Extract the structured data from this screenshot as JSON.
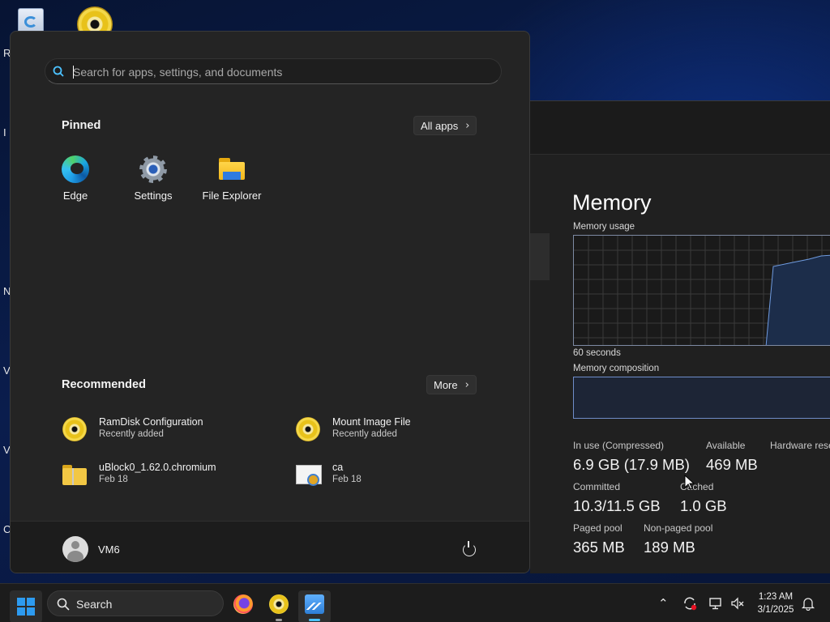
{
  "desktop": {
    "edge_letters": [
      "R",
      "I",
      "N",
      "V",
      "V",
      "C"
    ]
  },
  "start_menu": {
    "search": {
      "placeholder": "Search for apps, settings, and documents",
      "value": ""
    },
    "pinned": {
      "title": "Pinned",
      "all_apps_label": "All apps",
      "items": [
        {
          "label": "Edge",
          "icon": "edge-icon"
        },
        {
          "label": "Settings",
          "icon": "gear-icon"
        },
        {
          "label": "File Explorer",
          "icon": "folder-icon"
        }
      ]
    },
    "recommended": {
      "title": "Recommended",
      "more_label": "More",
      "items": [
        {
          "name": "RamDisk Configuration",
          "sub": "Recently added",
          "icon": "disc-icon"
        },
        {
          "name": "Mount Image File",
          "sub": "Recently added",
          "icon": "disc-icon"
        },
        {
          "name": "uBlock0_1.62.0.chromium",
          "sub": "Feb 18",
          "icon": "zip-folder-icon"
        },
        {
          "name": "ca",
          "sub": "Feb 18",
          "icon": "certificate-icon"
        }
      ]
    },
    "footer": {
      "user_name": "VM6",
      "power_icon": "power-icon"
    }
  },
  "task_manager": {
    "heading": "Memory",
    "memory_usage_label": "Memory usage",
    "graph_time_label": "60 seconds",
    "composition_label": "Memory composition",
    "stats": {
      "in_use_label": "In use (Compressed)",
      "in_use_value": "6.9 GB (17.9 MB)",
      "available_label": "Available",
      "available_value": "469 MB",
      "hardware_reserved_label": "Hardware rese",
      "committed_label": "Committed",
      "committed_value": "10.3/11.5 GB",
      "cached_label": "Cached",
      "cached_value": "1.0 GB",
      "paged_pool_label": "Paged pool",
      "paged_pool_value": "365 MB",
      "non_paged_pool_label": "Non-paged pool",
      "non_paged_pool_value": "189 MB"
    }
  },
  "taskbar": {
    "search_label": "Search",
    "apps": [
      {
        "name": "Firefox",
        "icon": "firefox-icon",
        "running": false
      },
      {
        "name": "Disc tool",
        "icon": "disc-icon",
        "running": true
      },
      {
        "name": "Task Manager",
        "icon": "task-manager-icon",
        "running": true,
        "active": true
      }
    ],
    "clock": {
      "time": "1:23 AM",
      "date": "3/1/2025"
    }
  },
  "colors": {
    "accent": "#4cc2ff",
    "windows_blue": "#2d9bf0",
    "start_bg": "#242424",
    "taskbar_bg": "#1c1c1c"
  }
}
